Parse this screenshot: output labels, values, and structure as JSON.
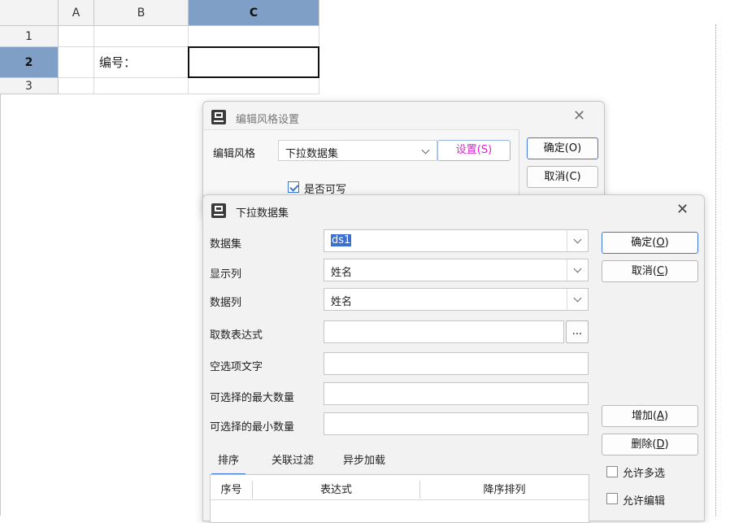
{
  "sheet": {
    "columns": [
      "A",
      "B",
      "C"
    ],
    "rows": [
      "1",
      "2",
      "3"
    ],
    "b2": "编号："
  },
  "style_dialog": {
    "title": "编辑风格设置",
    "edit_style_label": "编辑风格",
    "edit_style_value": "下拉数据集",
    "settings_button": "设置(S)",
    "ok_button": "确定(O)",
    "cancel_button": "取消(C)",
    "writable_label": "是否可写",
    "writable_checked": true
  },
  "dropdown_dialog": {
    "title": "下拉数据集",
    "fields": {
      "dataset_label": "数据集",
      "dataset_value": "ds1",
      "display_col_label": "显示列",
      "display_col_value": "姓名",
      "data_col_label": "数据列",
      "data_col_value": "姓名",
      "expr_label": "取数表达式",
      "expr_button": "...",
      "empty_text_label": "空选项文字",
      "max_label": "可选择的最大数量",
      "min_label": "可选择的最小数量"
    },
    "buttons": {
      "ok_prefix": "确定(",
      "ok_key": "O",
      "ok_suffix": ")",
      "cancel_prefix": "取消(",
      "cancel_key": "C",
      "cancel_suffix": ")",
      "add_prefix": "增加(",
      "add_key": "A",
      "add_suffix": ")",
      "delete_prefix": "删除(",
      "delete_key": "D",
      "delete_suffix": ")"
    },
    "checkboxes": {
      "multi_select": "允许多选",
      "allow_edit": "允许编辑"
    },
    "tabs": [
      "排序",
      "关联过滤",
      "异步加载"
    ],
    "active_tab": 0,
    "table_headers": [
      "序号",
      "表达式",
      "降序排列"
    ]
  },
  "colors": {
    "selected_header": "#7f9fc7",
    "accent": "#3d78d8",
    "settings_text": "#e020d0"
  }
}
